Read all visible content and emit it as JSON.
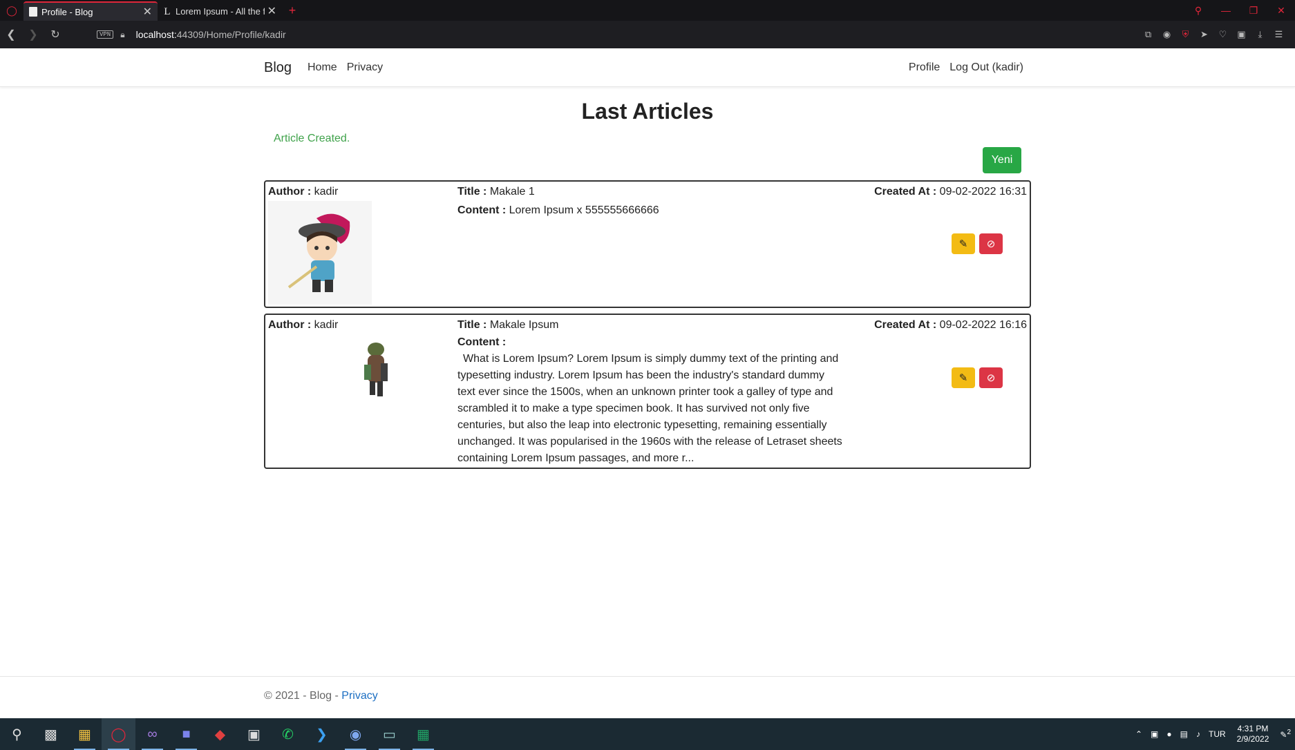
{
  "browser": {
    "tabs": [
      {
        "label": "Profile - Blog",
        "active": true,
        "icon": "document-icon"
      },
      {
        "label": "Lorem Ipsum - All the facts",
        "active": false,
        "icon": "lipsum-icon"
      }
    ],
    "url_host": "localhost:",
    "url_path": "44309/Home/Profile/kadir",
    "vpn_label": "VPN"
  },
  "navbar": {
    "brand": "Blog",
    "left_links": [
      "Home",
      "Privacy"
    ],
    "profile_link": "Profile",
    "logout_link": "Log Out (kadir)"
  },
  "main": {
    "heading": "Last Articles",
    "alert": "Article Created.",
    "new_button": "Yeni"
  },
  "labels": {
    "author": "Author :",
    "title": "Title :",
    "content": "Content :",
    "created": "Created At :"
  },
  "articles": [
    {
      "author": "kadir",
      "title": "Makale 1",
      "content": "Lorem Ipsum x 555555666666",
      "created_at": "09-02-2022 16:31"
    },
    {
      "author": "kadir",
      "title": "Makale Ipsum",
      "content": "What is Lorem Ipsum? Lorem Ipsum is simply dummy text of the printing and typesetting industry. Lorem Ipsum has been the industry's standard dummy text ever since the 1500s, when an unknown printer took a galley of type and scrambled it to make a type specimen book. It has survived not only five centuries, but also the leap into electronic typesetting, remaining essentially unchanged. It was popularised in the 1960s with the release of Letraset sheets containing Lorem Ipsum passages, and more r...",
      "created_at": "09-02-2022 16:16"
    }
  ],
  "footer": {
    "text": "© 2021 - Blog -",
    "link": "Privacy"
  },
  "taskbar": {
    "lang": "TUR",
    "time": "4:31 PM",
    "date": "2/9/2022",
    "notif_count": "2"
  },
  "colors": {
    "success": "#28a745",
    "warning": "#f3bb14",
    "danger": "#dc3545",
    "link": "#1b6ec2",
    "opera_red": "#e0263a"
  }
}
